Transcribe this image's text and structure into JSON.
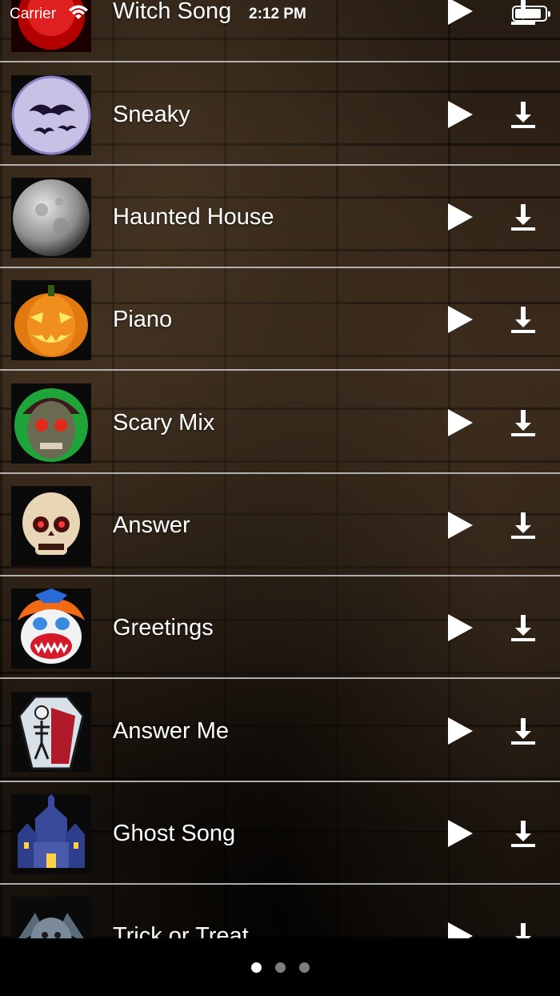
{
  "status": {
    "carrier": "Carrier",
    "time": "2:12 PM"
  },
  "songs": [
    {
      "title": "Witch Song",
      "thumb": "devil-icon"
    },
    {
      "title": "Sneaky",
      "thumb": "bats-moon-icon"
    },
    {
      "title": "Haunted House",
      "thumb": "full-moon-icon"
    },
    {
      "title": "Piano",
      "thumb": "jack-o-lantern-icon"
    },
    {
      "title": "Scary Mix",
      "thumb": "zombie-face-icon"
    },
    {
      "title": "Answer",
      "thumb": "skull-icon"
    },
    {
      "title": "Greetings",
      "thumb": "evil-clown-icon"
    },
    {
      "title": "Answer Me",
      "thumb": "skeleton-coffin-icon"
    },
    {
      "title": "Ghost Song",
      "thumb": "haunted-castle-icon"
    },
    {
      "title": "Trick or Treat",
      "thumb": "gargoyle-icon"
    }
  ],
  "page_control": {
    "pages": 3,
    "current": 1
  }
}
